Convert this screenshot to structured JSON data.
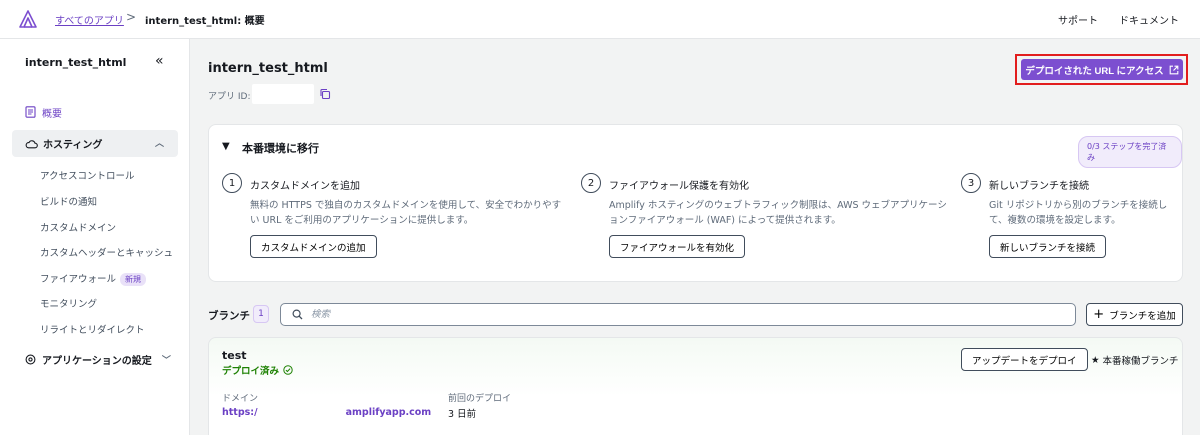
{
  "header": {
    "breadcrumb_link": "すべてのアプリ",
    "breadcrumb_separator": ">",
    "breadcrumb_current": "intern_test_html: 概要",
    "support": "サポート",
    "docs": "ドキュメント"
  },
  "sidebar": {
    "app_name": "intern_test_html",
    "overview": "概要",
    "hosting": {
      "label": "ホスティング",
      "items": [
        {
          "label": "アクセスコントロール"
        },
        {
          "label": "ビルドの通知"
        },
        {
          "label": "カスタムドメイン"
        },
        {
          "label": "カスタムヘッダーとキャッシュ"
        },
        {
          "label": "ファイアウォール",
          "badge": "新規"
        },
        {
          "label": "モニタリング"
        },
        {
          "label": "リライトとリダイレクト"
        }
      ]
    },
    "app_settings": "アプリケーションの設定"
  },
  "main": {
    "app_title": "intern_test_html",
    "app_id_label": "アプリ ID:",
    "deploy_url_button": "デプロイされた URL にアクセス",
    "production": {
      "title": "本番環境に移行",
      "steps_badge": "0/3 ステップを完了済み",
      "steps": [
        {
          "num": "1",
          "title": "カスタムドメインを追加",
          "desc": "無料の HTTPS で独自のカスタムドメインを使用して、安全でわかりやすい URL をご利用のアプリケーションに提供します。",
          "button": "カスタムドメインの追加"
        },
        {
          "num": "2",
          "title": "ファイアウォール保護を有効化",
          "desc": "Amplify ホスティングのウェブトラフィック制限は、AWS ウェブアプリケーションファイアウォール (WAF) によって提供されます。",
          "button": "ファイアウォールを有効化"
        },
        {
          "num": "3",
          "title": "新しいブランチを接続",
          "desc": "Git リポジトリから別のブランチを接続して、複数の環境を設定します。",
          "button": "新しいブランチを接続"
        }
      ]
    },
    "branches": {
      "label": "ブランチ",
      "count": "1",
      "search_placeholder": "検索",
      "add_button": "ブランチを追加",
      "items": [
        {
          "name": "test",
          "status": "デプロイ済み",
          "redeploy_button": "アップデートをデプロイ",
          "production_label": "本番稼働ブランチ",
          "domain_label": "ドメイン",
          "domain_prefix": "https:/",
          "domain_suffix": "amplifyapp.com",
          "last_deploy_label": "前回のデプロイ",
          "last_deploy_value": "3 日前"
        }
      ]
    }
  },
  "colors": {
    "accent": "#7c4fd0",
    "link": "#6b40c4",
    "success": "#1d8102",
    "highlight": "#e21d1d"
  }
}
